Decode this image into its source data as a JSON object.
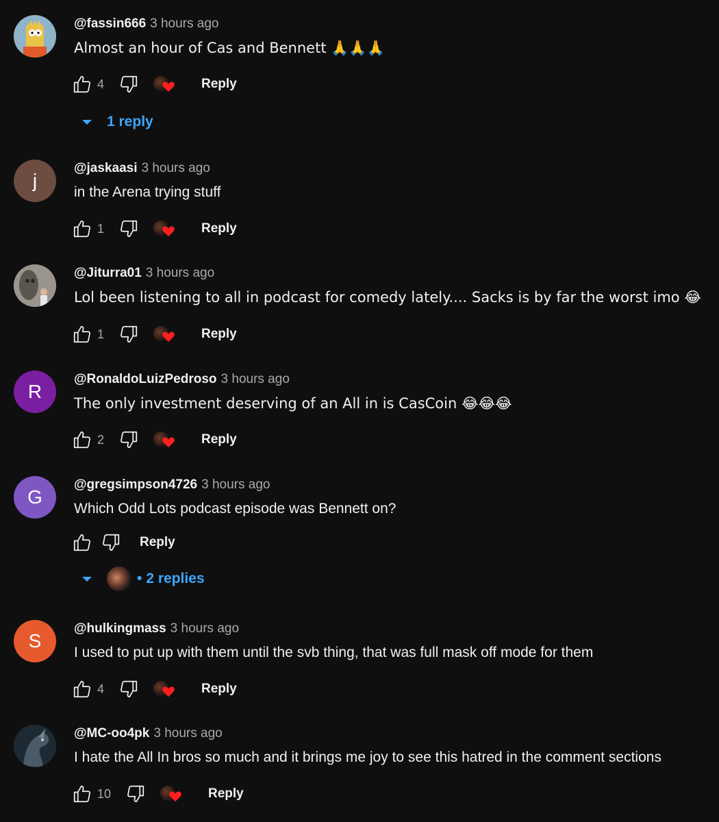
{
  "comments": [
    {
      "author": "@fassin666",
      "time": "3 hours ago",
      "text": "Almost an hour of Cas and Bennett 🙏🙏🙏",
      "likes": "4",
      "reply_label": "Reply",
      "replies_label": "1 reply",
      "avatar": {
        "type": "image",
        "icon": "simpsons-cartoon-avatar",
        "color": "#c8a24a"
      }
    },
    {
      "author": "@jaskaasi",
      "time": "3 hours ago",
      "text": "in the  Arena trying stuff",
      "likes": "1",
      "reply_label": "Reply",
      "avatar": {
        "type": "letter",
        "letter": "j",
        "color": "#6d4c41"
      }
    },
    {
      "author": "@Jiturra01",
      "time": "3 hours ago",
      "text": "Lol been listening to all in podcast for comedy lately.... Sacks is by far the worst imo 😂",
      "likes": "1",
      "reply_label": "Reply",
      "avatar": {
        "type": "image",
        "icon": "photo-avatar",
        "color": "#8a8478"
      }
    },
    {
      "author": "@RonaldoLuizPedroso",
      "time": "3 hours ago",
      "text": "The only investment deserving of an All in is CasCoin 😂😂😂",
      "likes": "2",
      "reply_label": "Reply",
      "avatar": {
        "type": "letter",
        "letter": "R",
        "color": "#7b1fa2"
      }
    },
    {
      "author": "@gregsimpson4726",
      "time": "3 hours ago",
      "text": "Which Odd Lots podcast episode was Bennett on?",
      "likes": "",
      "reply_label": "Reply",
      "replies_label": "2 replies",
      "replies_dot": "•",
      "avatar": {
        "type": "letter",
        "letter": "G",
        "color": "#7e57c2"
      }
    },
    {
      "author": "@hulkingmass",
      "time": "3 hours ago",
      "text": "I used to put up with them until the svb thing, that was full mask off mode for them",
      "likes": "4",
      "reply_label": "Reply",
      "avatar": {
        "type": "letter",
        "letter": "S",
        "color": "#e65a2e"
      }
    },
    {
      "author": "@MC-oo4pk",
      "time": "3 hours ago",
      "text": "I hate the All In bros so much and it brings me joy to see this hatred  in the comment sections",
      "likes": "10",
      "reply_label": "Reply",
      "avatar": {
        "type": "image",
        "icon": "dark-creature-avatar",
        "color": "#2b3640"
      }
    }
  ],
  "colors": {
    "background": "#0f0f0f",
    "link": "#3ea6ff",
    "muted": "#aaaaaa",
    "heart": "#ff1f1f"
  }
}
